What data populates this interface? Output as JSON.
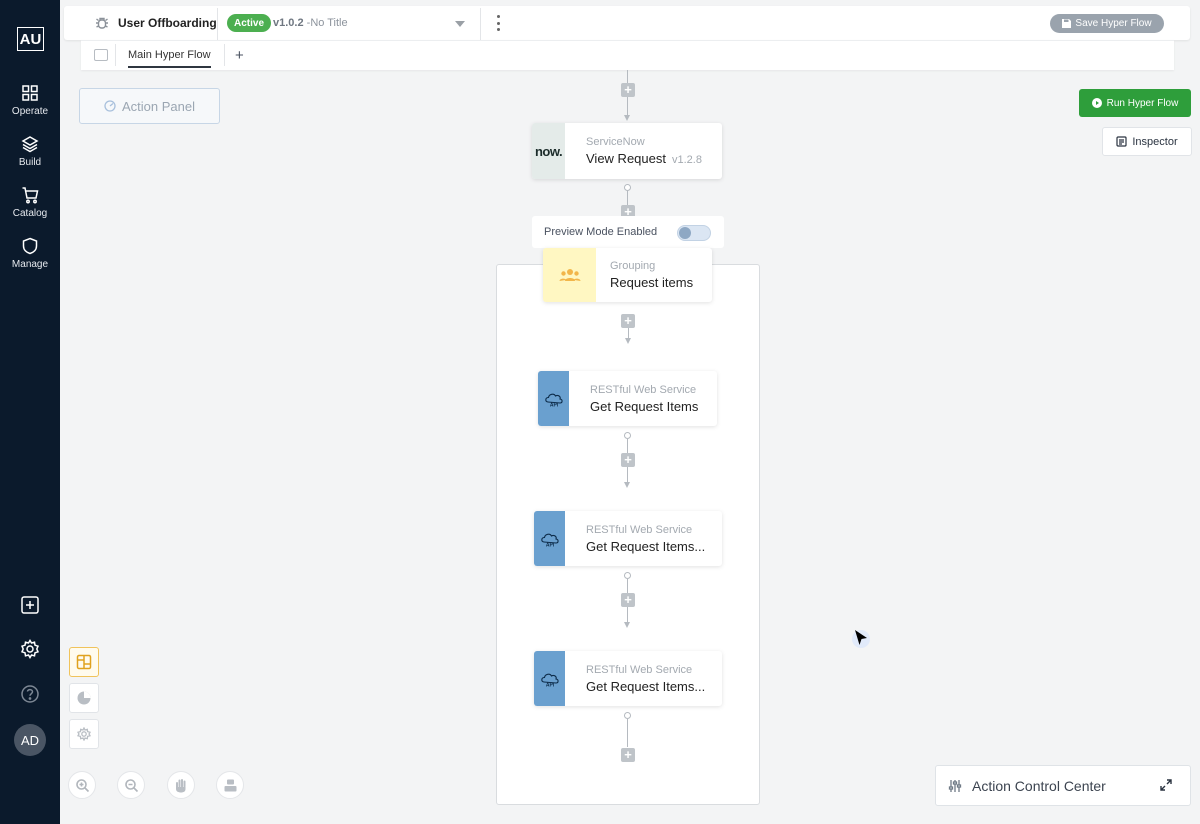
{
  "sidebar": {
    "logo": "AU",
    "items": [
      {
        "label": "Operate",
        "icon": "grid-icon"
      },
      {
        "label": "Build",
        "icon": "layers-icon"
      },
      {
        "label": "Catalog",
        "icon": "cart-icon"
      },
      {
        "label": "Manage",
        "icon": "shield-icon"
      }
    ],
    "avatar": "AD"
  },
  "header": {
    "flow_name": "User Offboarding",
    "status": "Active",
    "version": "v1.0.2",
    "version_title": "-No Title",
    "save_label": "Save Hyper Flow"
  },
  "tabs": {
    "main": "Main Hyper Flow",
    "add": "+"
  },
  "buttons": {
    "action_panel": "Action Panel",
    "run": "Run Hyper Flow",
    "inspector": "Inspector",
    "action_control_center": "Action Control Center"
  },
  "preview": {
    "label": "Preview Mode Enabled",
    "enabled": true
  },
  "nodes": {
    "servicenow": {
      "category": "ServiceNow",
      "title": "View Request",
      "version": "v1.2.8",
      "logo": "now."
    },
    "grouping": {
      "category": "Grouping",
      "title": "Request items"
    },
    "rest1": {
      "category": "RESTful Web Service",
      "title": "Get Request Items"
    },
    "rest2": {
      "category": "RESTful Web Service",
      "title": "Get Request Items..."
    },
    "rest3": {
      "category": "RESTful Web Service",
      "title": "Get Request Items..."
    }
  },
  "colors": {
    "sidebar": "#0b1a2c",
    "active": "#4caf50",
    "run": "#2e9e3b",
    "api_icon": "#6aa0cf",
    "group_icon": "#fff7c2"
  }
}
